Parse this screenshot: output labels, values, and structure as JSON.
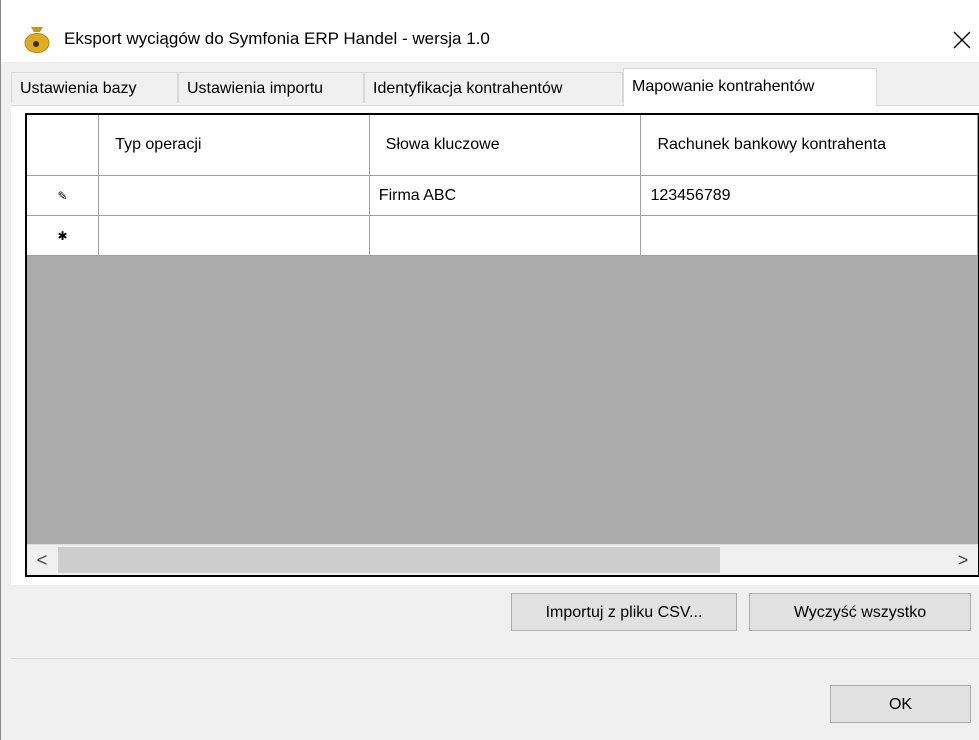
{
  "window": {
    "title": "Eksport wyciągów do Symfonia ERP Handel - wersja 1.0",
    "close_glyph": "✕"
  },
  "tabs": [
    {
      "label": "Ustawienia bazy"
    },
    {
      "label": "Ustawienia importu"
    },
    {
      "label": "Identyfikacja kontrahentów"
    },
    {
      "label": "Mapowanie kontrahentów",
      "active": true
    }
  ],
  "grid": {
    "columns": [
      "Typ operacji",
      "Słowa kluczowe",
      "Rachunek bankowy kontrahenta"
    ],
    "rows": [
      {
        "marker": "✎",
        "cells": [
          "",
          "Firma ABC",
          "123456789"
        ]
      },
      {
        "marker": "✱",
        "cells": [
          "",
          "",
          ""
        ]
      }
    ],
    "scroll_left": "<",
    "scroll_right": ">"
  },
  "buttons": {
    "import_csv": "Importuj z pliku CSV...",
    "clear_all": "Wyczyść wszystko",
    "ok": "OK"
  },
  "icons": {
    "app": "money-bag-icon",
    "close": "close-icon",
    "edit_row": "pencil-icon",
    "new_row": "asterisk-icon"
  },
  "colors": {
    "titlebar": "#ffffff",
    "dialog": "#f0f0f0",
    "grid_background": "#ababab",
    "button": "#e1e1e1"
  }
}
